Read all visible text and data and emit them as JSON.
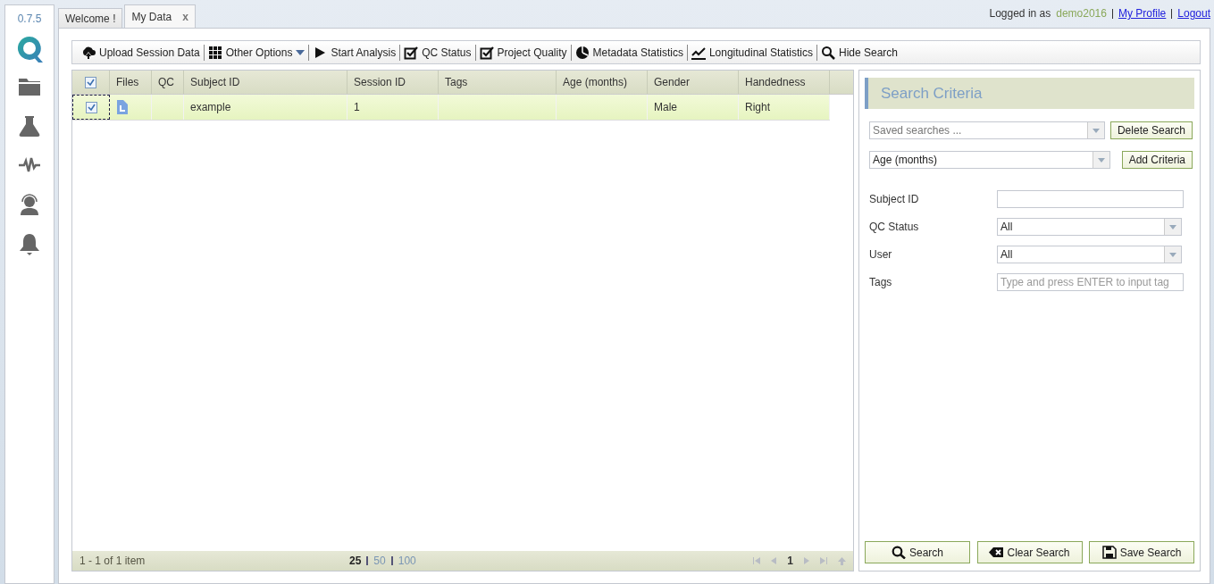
{
  "version": "0.7.5",
  "tabs": [
    {
      "label": "Welcome !",
      "selected": false,
      "closable": false
    },
    {
      "label": "My Data",
      "selected": true,
      "closable": true,
      "close": "x"
    }
  ],
  "user": {
    "prefix": "Logged in as",
    "name": "demo2016",
    "links": [
      "My Profile",
      "Logout"
    ]
  },
  "toolbar": [
    {
      "label": "Upload Session Data",
      "dropdown": false
    },
    {
      "label": "Other Options",
      "dropdown": true
    },
    {
      "label": "Start Analysis",
      "dropdown": false
    },
    {
      "label": "QC Status",
      "dropdown": false
    },
    {
      "label": "Project Quality",
      "dropdown": false
    },
    {
      "label": "Metadata Statistics",
      "dropdown": false
    },
    {
      "label": "Longitudinal Statistics",
      "dropdown": false
    },
    {
      "label": "Hide Search",
      "dropdown": false
    }
  ],
  "table": {
    "all_checked": true,
    "columns": [
      "Files",
      "QC",
      "Subject ID",
      "Session ID",
      "Tags",
      "Age (months)",
      "Gender",
      "Handedness"
    ],
    "rows": [
      {
        "checked": true,
        "selected": true,
        "has_file": true,
        "cells": [
          "",
          "",
          "example",
          "1",
          "",
          "",
          "Male",
          "Right"
        ]
      }
    ]
  },
  "pager": {
    "summary": "1 - 1 of 1 item",
    "page_sizes": [
      {
        "label": "25",
        "selected": true
      },
      {
        "label": "50",
        "selected": false
      },
      {
        "label": "100",
        "selected": false
      }
    ],
    "page": "1"
  },
  "search": {
    "title": "Search Criteria",
    "saved": {
      "placeholder": "Saved searches ..."
    },
    "delete_button": "Delete Search",
    "criteria": {
      "value": "Age (months)"
    },
    "add_button": "Add Criteria",
    "fields": [
      {
        "kind": "text",
        "label": "Subject ID"
      },
      {
        "kind": "select",
        "label": "QC Status",
        "value": "All"
      },
      {
        "kind": "select",
        "label": "User",
        "value": "All"
      },
      {
        "kind": "tags",
        "label": "Tags",
        "placeholder": "Type and press ENTER to input tag"
      }
    ],
    "buttons": [
      "Search",
      "Clear Search",
      "Save Search"
    ]
  }
}
